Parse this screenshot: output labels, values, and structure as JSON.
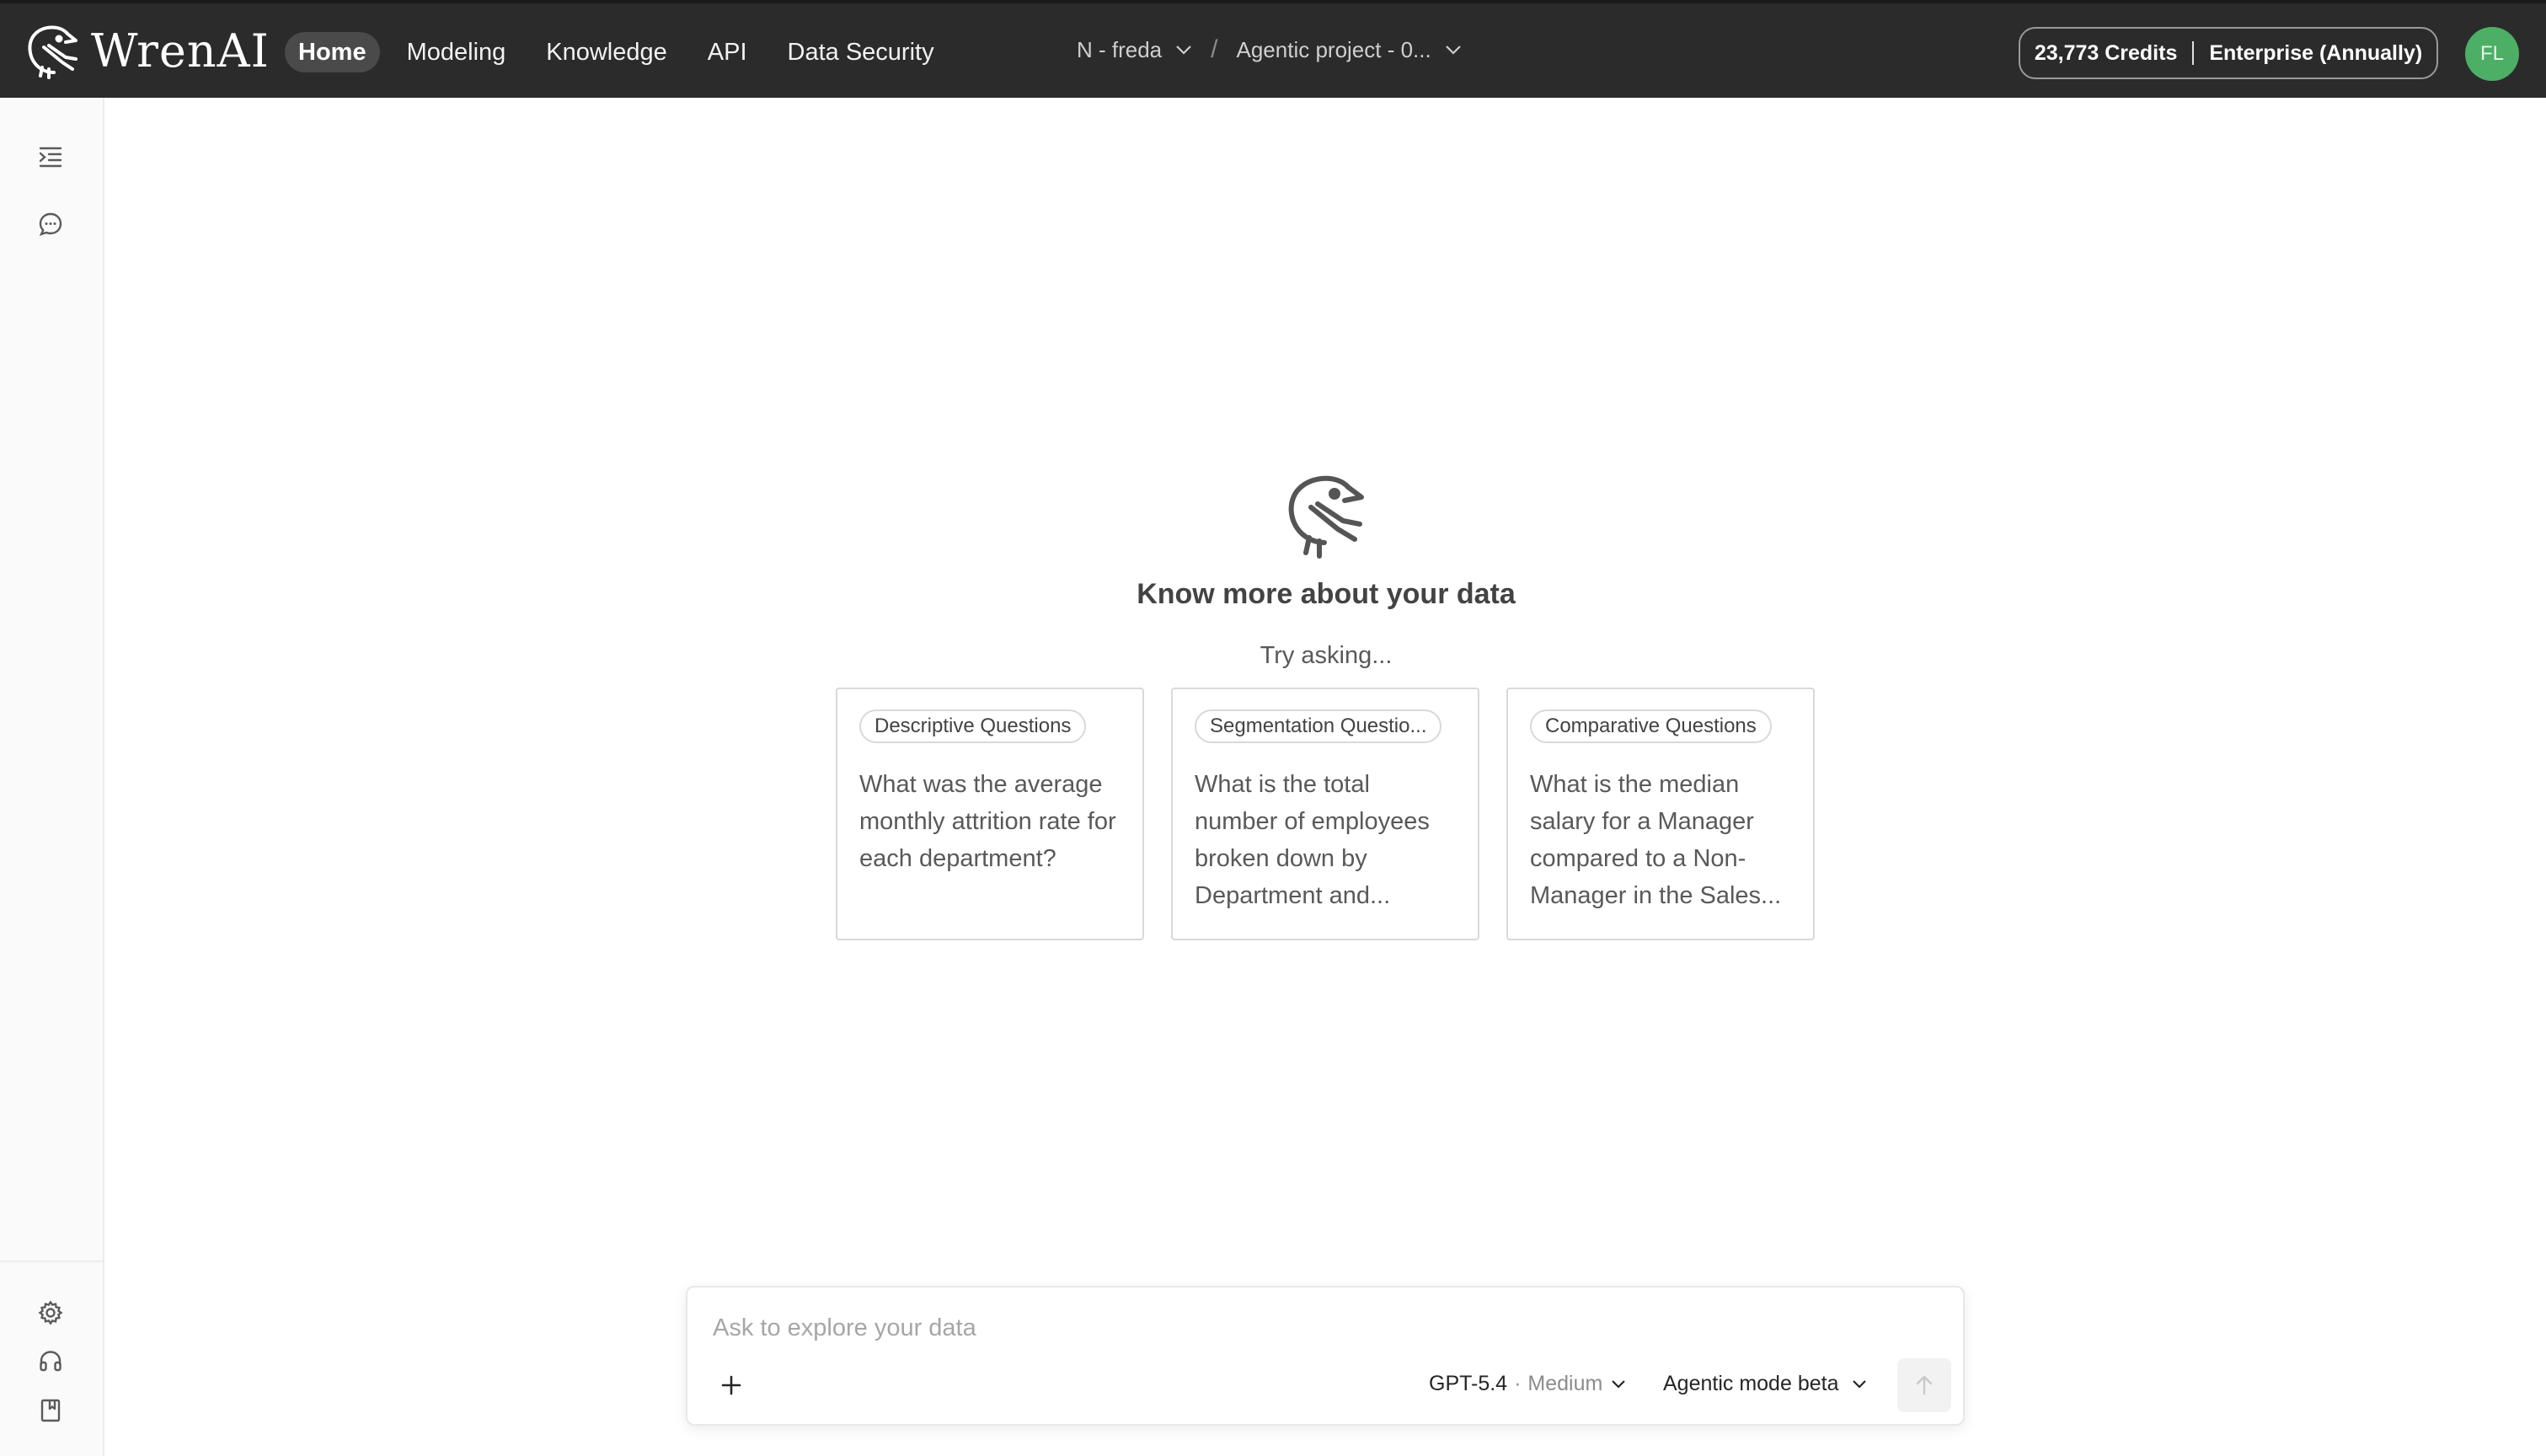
{
  "app": {
    "brand_name": "WrenAI"
  },
  "nav": {
    "items": [
      {
        "label": "Home",
        "active": true
      },
      {
        "label": "Modeling",
        "active": false
      },
      {
        "label": "Knowledge",
        "active": false
      },
      {
        "label": "API",
        "active": false
      },
      {
        "label": "Data Security",
        "active": false
      }
    ]
  },
  "breadcrumb": {
    "workspace": "N - freda",
    "separator": "/",
    "project": "Agentic project - 0..."
  },
  "account": {
    "credits": "23,773 Credits",
    "plan": "Enterprise (Annually)",
    "avatar_initials": "FL",
    "avatar_color": "#4caf65"
  },
  "sidebar": {
    "top_icons": [
      "list-indent-icon",
      "chat-bubble-icon"
    ],
    "bottom_icons": [
      "gear-icon",
      "headset-icon",
      "book-icon"
    ]
  },
  "hero": {
    "title": "Know more about your data",
    "subtitle": "Try asking..."
  },
  "suggestions": [
    {
      "tag": "Descriptive Questions",
      "text": "What was the average monthly attrition rate for each department?"
    },
    {
      "tag": "Segmentation Questio...",
      "text": "What is the total number of employees broken down by Department and..."
    },
    {
      "tag": "Comparative Questions",
      "text": "What is the median salary for a Manager compared to a Non-Manager in the Sales..."
    }
  ],
  "prompt": {
    "placeholder": "Ask to explore your data",
    "value": "",
    "model": "GPT-5.4",
    "model_separator": "·",
    "reasoning_level": "Medium",
    "mode": "Agentic mode beta"
  },
  "colors": {
    "topbar_bg": "#2b2b2b",
    "nav_active_bg": "#4a4a4a",
    "avatar": "#4caf65"
  }
}
